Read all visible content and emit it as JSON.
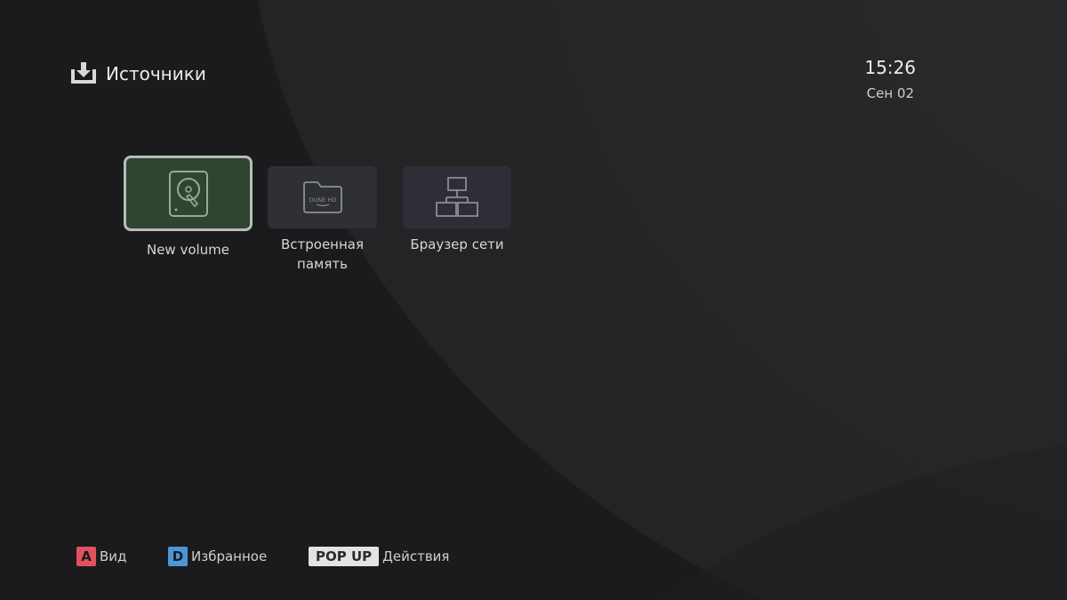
{
  "header": {
    "title": "Источники",
    "icon": "download-tray-icon"
  },
  "clock": {
    "time": "15:26",
    "date": "Сен 02"
  },
  "sources": [
    {
      "label": "New volume",
      "icon": "hard-drive-icon",
      "selected": true,
      "color": "#2f4431"
    },
    {
      "label": "Встроенная\nпамять",
      "icon": "dune-folder-icon",
      "selected": false,
      "color": "#2f3036"
    },
    {
      "label": "Браузер сети",
      "icon": "network-icon",
      "selected": false,
      "color": "#2f2d36"
    }
  ],
  "footer": {
    "hints": [
      {
        "key": "A",
        "label": "Вид",
        "color": "#e0525f"
      },
      {
        "key": "D",
        "label": "Избранное",
        "color": "#4b97d6"
      },
      {
        "key": "POP UP",
        "label": "Действия",
        "color": "#e3e3e3"
      }
    ]
  },
  "logo_text": "DUNE HD"
}
